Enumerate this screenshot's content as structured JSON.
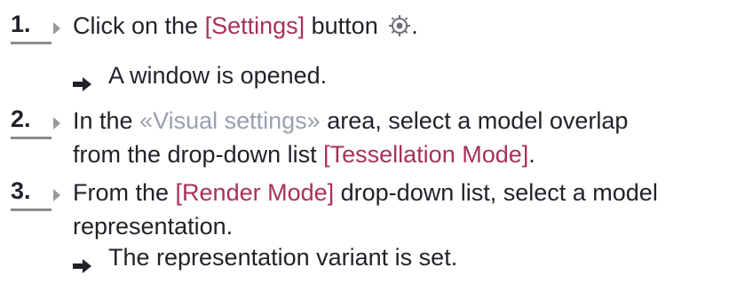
{
  "steps": [
    {
      "number": "1.",
      "text_before": "Click on the ",
      "keyword": "[Settings]",
      "text_after": " button",
      "punct": ".",
      "icon": "gear-icon",
      "result": "A window is opened."
    },
    {
      "number": "2.",
      "line1_before": "In the ",
      "area": "«Visual settings»",
      "line1_after": " area, select a model overlap",
      "line2_before": "from the drop-down list ",
      "keyword": "[Tessellation Mode]",
      "line2_after": "."
    },
    {
      "number": "3.",
      "line1_before": "From the ",
      "keyword": "[Render Mode]",
      "line1_after": " drop-down list, select a model",
      "line2": "representation.",
      "result": "The representation variant is set."
    }
  ],
  "colors": {
    "keyword": "#a7305c",
    "area": "#9aa0b1",
    "text": "#1f2328",
    "marker": "#8c8c8c"
  }
}
